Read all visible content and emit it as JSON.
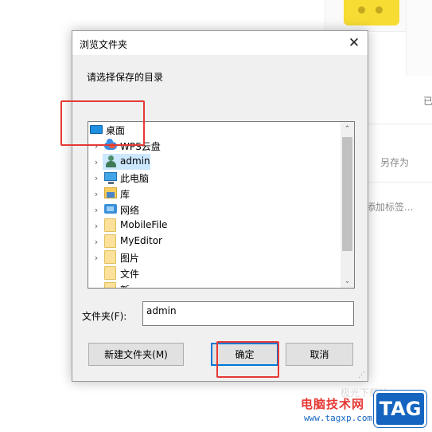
{
  "background_app": {
    "save_as_label": "另存为",
    "add_tag_label": "添加标签...",
    "status_fragment": "已"
  },
  "dialog": {
    "title": "浏览文件夹",
    "close_glyph": "✕",
    "prompt": "请选择保存的目录",
    "tree": {
      "items": [
        {
          "label": "桌面",
          "icon": "desktop-icon",
          "expandable": false,
          "selected": false
        },
        {
          "label": "WPS云盘",
          "icon": "cloud-icon",
          "expandable": true
        },
        {
          "label": "admin",
          "icon": "user-icon",
          "expandable": true,
          "selected": true
        },
        {
          "label": "此电脑",
          "icon": "computer-icon",
          "expandable": true
        },
        {
          "label": "库",
          "icon": "library-icon",
          "expandable": true
        },
        {
          "label": "网络",
          "icon": "network-icon",
          "expandable": true
        },
        {
          "label": "MobileFile",
          "icon": "folder-icon",
          "expandable": true
        },
        {
          "label": "MyEditor",
          "icon": "folder-icon",
          "expandable": true
        },
        {
          "label": "图片",
          "icon": "folder-icon",
          "expandable": true
        },
        {
          "label": "文件",
          "icon": "folder-icon",
          "expandable": false
        },
        {
          "label": "新",
          "icon": "folder-icon",
          "expandable": false
        }
      ],
      "scroll_up_glyph": "⌃",
      "scroll_down_glyph": "⌄"
    },
    "folder_label": "文件夹(F):",
    "folder_value": "admin",
    "buttons": {
      "new_folder": "新建文件夹(M)",
      "ok": "确定",
      "cancel": "取消"
    }
  },
  "watermark": {
    "site_name": "电脑技术网",
    "url": "www.tagxp.com",
    "badge": "TAG",
    "faint_text": "极光下载站"
  },
  "colors": {
    "annotation": "#e53935",
    "selection": "#cce8ff",
    "primary_button_border": "#0078d7"
  }
}
